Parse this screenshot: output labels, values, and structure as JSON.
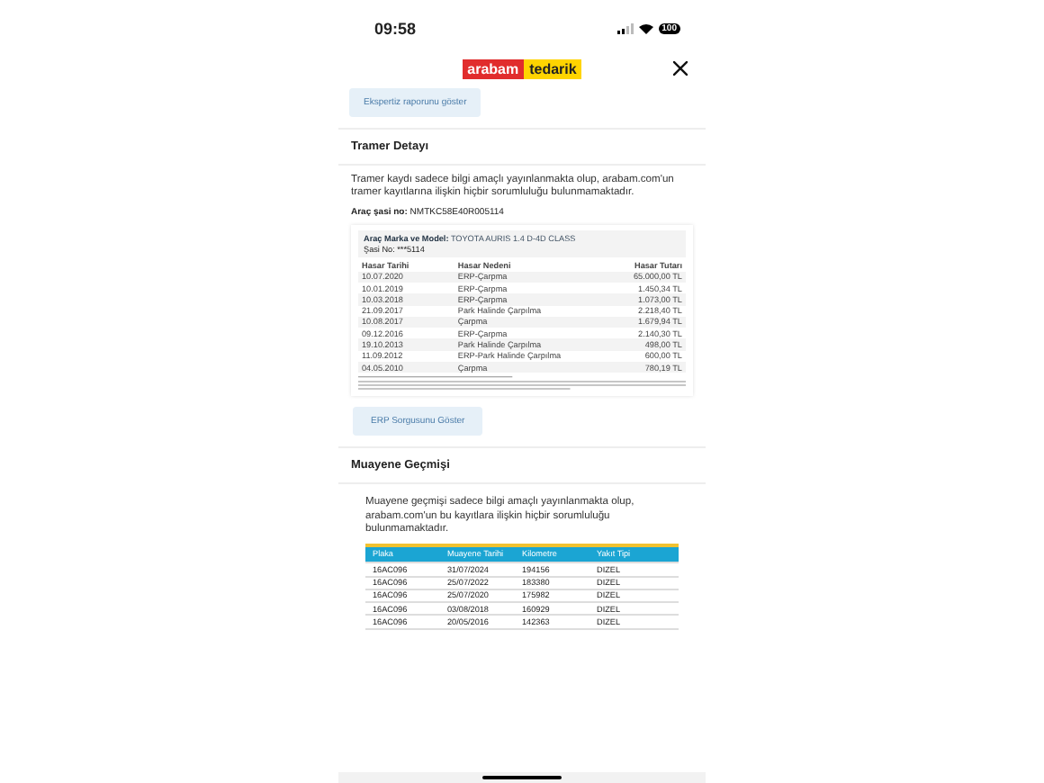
{
  "status_bar": {
    "time": "09:58",
    "battery": "100"
  },
  "header": {
    "logo_left": "arabam",
    "logo_right": "tedarik"
  },
  "expertise_button": "Ekspertiz raporunu göster",
  "tramer": {
    "title": "Tramer Detayı",
    "notice": "Tramer kaydı sadece bilgi amaçlı yayınlanmakta olup, arabam.com'un tramer kayıtlarına ilişkin hiçbir sorumluluğu bulunmamaktadır.",
    "chassis_label": "Araç şasi no:",
    "chassis_value": "NMTKC58E40R005114",
    "document": {
      "model_label": "Araç Marka ve Model:",
      "model_value": "TOYOTA AURIS 1.4 D-4D CLASS",
      "chassis": "Şasi No: ***5114",
      "columns": [
        "Hasar Tarihi",
        "Hasar Nedeni",
        "Hasar Tutarı"
      ],
      "rows": [
        [
          "10.07.2020",
          "ERP-Çarpma",
          "65.000,00 TL"
        ],
        [
          "10.01.2019",
          "ERP-Çarpma",
          "1.450,34 TL"
        ],
        [
          "10.03.2018",
          "ERP-Çarpma",
          "1.073,00 TL"
        ],
        [
          "21.09.2017",
          "Park Halinde Çarpılma",
          "2.218,40 TL"
        ],
        [
          "10.08.2017",
          "Çarpma",
          "1.679,94 TL"
        ],
        [
          "09.12.2016",
          "ERP-Çarpma",
          "2.140,30 TL"
        ],
        [
          "19.10.2013",
          "Park Halinde Çarpılma",
          "498,00 TL"
        ],
        [
          "11.09.2012",
          "ERP-Park Halinde Çarpılma",
          "600,00 TL"
        ],
        [
          "04.05.2010",
          "Çarpma",
          "780,19 TL"
        ]
      ]
    }
  },
  "erp_button": "ERP Sorgusunu Göster",
  "inspection": {
    "title": "Muayene Geçmişi",
    "notice": "Muayene geçmişi sadece bilgi amaçlı yayınlanmakta olup, arabam.com'un bu kayıtlara ilişkin hiçbir sorumluluğu bulunmamaktadır.",
    "columns": [
      "Plaka",
      "Muayene Tarihi",
      "Kilometre",
      "Yakıt Tipi"
    ],
    "rows": [
      [
        "16AC096",
        "31/07/2024",
        "194156",
        "DIZEL"
      ],
      [
        "16AC096",
        "25/07/2022",
        "183380",
        "DIZEL"
      ],
      [
        "16AC096",
        "25/07/2020",
        "175982",
        "DIZEL"
      ],
      [
        "16AC096",
        "03/08/2018",
        "160929",
        "DIZEL"
      ],
      [
        "16AC096",
        "20/05/2016",
        "142363",
        "DIZEL"
      ]
    ]
  }
}
